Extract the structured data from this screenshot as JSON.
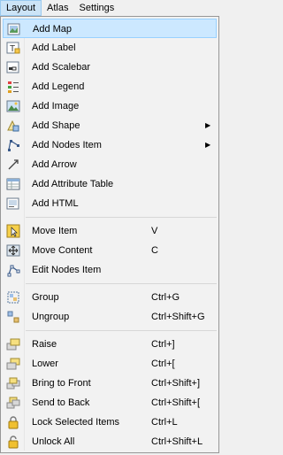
{
  "menubar": {
    "layout": "Layout",
    "atlas": "Atlas",
    "settings": "Settings"
  },
  "menu": {
    "add_map": "Add Map",
    "add_label": "Add Label",
    "add_scalebar": "Add Scalebar",
    "add_legend": "Add Legend",
    "add_image": "Add Image",
    "add_shape": "Add Shape",
    "add_nodes_item": "Add Nodes Item",
    "add_arrow": "Add Arrow",
    "add_attribute_table": "Add Attribute Table",
    "add_html": "Add HTML",
    "move_item": "Move Item",
    "move_item_shortcut": "V",
    "move_content": "Move Content",
    "move_content_shortcut": "C",
    "edit_nodes_item": "Edit Nodes Item",
    "group": "Group",
    "group_shortcut": "Ctrl+G",
    "ungroup": "Ungroup",
    "ungroup_shortcut": "Ctrl+Shift+G",
    "raise": "Raise",
    "raise_shortcut": "Ctrl+]",
    "lower": "Lower",
    "lower_shortcut": "Ctrl+[",
    "bring_to_front": "Bring to Front",
    "bring_to_front_shortcut": "Ctrl+Shift+]",
    "send_to_back": "Send to Back",
    "send_to_back_shortcut": "Ctrl+Shift+[",
    "lock_selected_items": "Lock Selected Items",
    "lock_selected_items_shortcut": "Ctrl+L",
    "unlock_all": "Unlock All",
    "unlock_all_shortcut": "Ctrl+Shift+L",
    "submenu_arrow": "▶"
  },
  "colors": {
    "highlight": "#cce8ff",
    "highlight_border": "#99d1ff",
    "menu_bg": "#f2f2f2"
  }
}
